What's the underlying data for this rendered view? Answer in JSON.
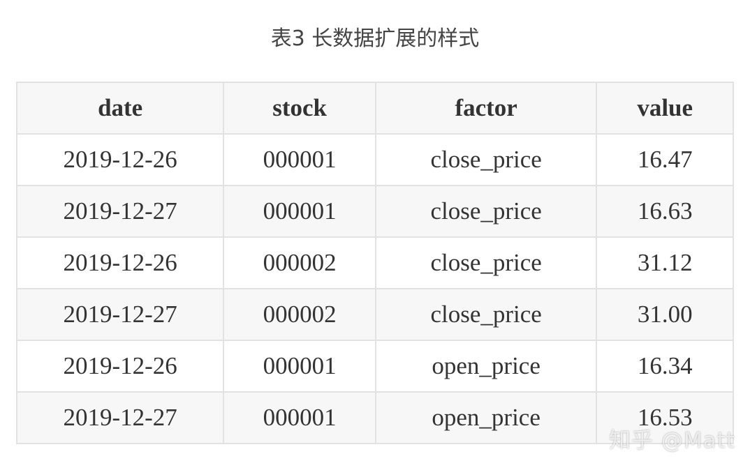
{
  "caption": "表3 长数据扩展的样式",
  "table": {
    "headers": [
      "date",
      "stock",
      "factor",
      "value"
    ],
    "rows": [
      [
        "2019-12-26",
        "000001",
        "close_price",
        "16.47"
      ],
      [
        "2019-12-27",
        "000001",
        "close_price",
        "16.63"
      ],
      [
        "2019-12-26",
        "000002",
        "close_price",
        "31.12"
      ],
      [
        "2019-12-27",
        "000002",
        "close_price",
        "31.00"
      ],
      [
        "2019-12-26",
        "000001",
        "open_price",
        "16.34"
      ],
      [
        "2019-12-27",
        "000001",
        "open_price",
        "16.53"
      ]
    ]
  },
  "watermark": "知乎 @Matt"
}
